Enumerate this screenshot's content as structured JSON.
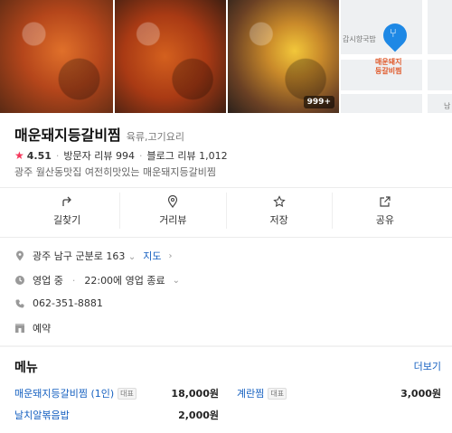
{
  "photos": {
    "more_count": "999+"
  },
  "map_thumb": {
    "place_label_line1": "매운돼지",
    "place_label_line2": "등갈비찜",
    "nearby_label": "갑시향국밥",
    "road_label": "남"
  },
  "place": {
    "name": "매운돼지등갈비찜",
    "category": "육류,고기요리",
    "rating": "4.51",
    "visitor_reviews_label": "방문자 리뷰",
    "visitor_reviews": "994",
    "blog_reviews_label": "블로그 리뷰",
    "blog_reviews": "1,012",
    "description": "광주 월산동맛집 여전히맛있는 매운돼지등갈비찜"
  },
  "actions": [
    {
      "label": "길찾기",
      "icon": "directions-icon"
    },
    {
      "label": "거리뷰",
      "icon": "location-pin-icon"
    },
    {
      "label": "저장",
      "icon": "star-icon"
    },
    {
      "label": "공유",
      "icon": "share-icon"
    }
  ],
  "info": {
    "address": "광주 남구 군분로 163",
    "map_link": "지도",
    "status": "영업 중",
    "hours": "22:00에 영업 종료",
    "phone": "062-351-8881",
    "reservation": "예약"
  },
  "menu": {
    "title": "메뉴",
    "more": "더보기",
    "rep_badge": "대표",
    "items": [
      {
        "name": "매운돼지등갈비찜 (1인)",
        "price": "18,000원",
        "rep": true
      },
      {
        "name": "계란찜",
        "price": "3,000원",
        "rep": true
      },
      {
        "name": "날치알볶음밥",
        "price": "2,000원",
        "rep": false
      }
    ]
  },
  "colors": {
    "link": "#1560c0",
    "star": "#f5375b",
    "pin": "#1e88e5"
  }
}
